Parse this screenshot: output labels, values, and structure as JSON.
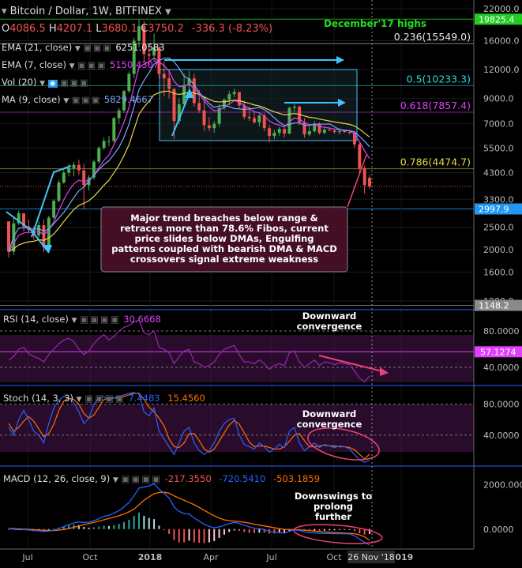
{
  "header": {
    "symbol": "Bitcoin / Dollar, 1W, BITFINEX",
    "ohlc": [
      {
        "label": "O",
        "value": "4086.5"
      },
      {
        "label": "H",
        "value": "4207.1"
      },
      {
        "label": "L",
        "value": "3680.1"
      },
      {
        "label": "C",
        "value": "3750.2"
      }
    ],
    "change": "-336.3 (-8.23%)"
  },
  "indicators": [
    {
      "label": "EMA (21, close)",
      "value": "6251.0583",
      "color": "#e8e8e8"
    },
    {
      "label": "EMA (7, close)",
      "value": "5150.4307",
      "color": "#e040fb"
    },
    {
      "label": "Vol (20)",
      "value": "",
      "color": "#26a69a"
    },
    {
      "label": "MA (9, close)",
      "value": "5829.4667",
      "color": "#7ea6ff"
    }
  ],
  "annotations": {
    "dec17": "December'17 highs",
    "note": [
      "Major trend breaches below range &",
      "retraces more than 78.6% Fibos, current",
      "price slides below DMAs, Engulfing",
      "patterns coupled with bearish DMA & MACD",
      "crossovers signal extreme weakness"
    ],
    "rsi_note": [
      "Downward",
      "convergence"
    ],
    "stoch_note": [
      "Downward",
      "convergence"
    ],
    "macd_note": [
      "Downswings to",
      "prolong further"
    ]
  },
  "chart_data": [
    {
      "type": "candlestick",
      "yscale": "log",
      "ylim": [
        1100,
        24000
      ],
      "x_ticks": [
        "Jul",
        "Oct",
        "2018",
        "Apr",
        "Jul",
        "Oct",
        "2019"
      ],
      "x_crosshair_label": "26 Nov '18",
      "y_ticks": [
        "22000.0",
        "16000.0",
        "12000.0",
        "9000.0",
        "7000.0",
        "5500.0",
        "4300.0",
        "3300.0",
        "2500.0",
        "2000.0",
        "1600.0",
        "1200.0"
      ],
      "price_tags": [
        {
          "label": "19825.4",
          "value": 19825.4,
          "color": "#22cc22"
        },
        {
          "label": "2997.9",
          "value": 2997.9,
          "color": "#2196f3"
        },
        {
          "label": "1148.2",
          "value": 1148.2,
          "color": "#8a8a8a"
        }
      ],
      "fib_levels": [
        {
          "label": "0.236(15549.0)",
          "value": 15549.0,
          "color": "#e8e8e8"
        },
        {
          "label": "0.5(10233.3)",
          "value": 10233.3,
          "color": "#2ed8d8"
        },
        {
          "label": "0.618(7857.4)",
          "value": 7857.4,
          "color": "#e040fb"
        },
        {
          "label": "0.786(4474.7)",
          "value": 4474.7,
          "color": "#e6d84a"
        }
      ],
      "ohlc_weekly": [
        [
          2650,
          2650,
          1850,
          1960
        ],
        [
          1960,
          2750,
          1900,
          2600
        ],
        [
          2600,
          2950,
          2550,
          2870
        ],
        [
          2870,
          2880,
          2400,
          2520
        ],
        [
          2520,
          2700,
          2350,
          2430
        ],
        [
          2430,
          2520,
          2200,
          2300
        ],
        [
          2300,
          2650,
          2250,
          2550
        ],
        [
          2550,
          2700,
          1950,
          2050
        ],
        [
          2050,
          2800,
          2000,
          2750
        ],
        [
          2750,
          3300,
          2700,
          3250
        ],
        [
          3250,
          4000,
          3200,
          3900
        ],
        [
          3900,
          4450,
          3850,
          4300
        ],
        [
          4300,
          4700,
          4150,
          4500
        ],
        [
          4500,
          4800,
          4150,
          4650
        ],
        [
          4650,
          4900,
          4200,
          4400
        ],
        [
          4400,
          4700,
          3000,
          3800
        ],
        [
          3800,
          4200,
          3600,
          4100
        ],
        [
          4100,
          4900,
          4000,
          4800
        ],
        [
          4800,
          5600,
          4700,
          5500
        ],
        [
          5500,
          6100,
          5400,
          5900
        ],
        [
          5900,
          6200,
          5600,
          5900
        ],
        [
          5900,
          7500,
          5800,
          7400
        ],
        [
          7400,
          8200,
          7000,
          8000
        ],
        [
          8000,
          9800,
          7800,
          9700
        ],
        [
          9700,
          11800,
          9500,
          11500
        ],
        [
          11500,
          16500,
          11000,
          16000
        ],
        [
          16000,
          19800,
          15000,
          18500
        ],
        [
          18500,
          19500,
          13000,
          14000
        ],
        [
          14000,
          15500,
          12500,
          13800
        ],
        [
          13800,
          17200,
          13000,
          15000
        ],
        [
          15000,
          15200,
          11000,
          11500
        ],
        [
          11500,
          13000,
          9200,
          11000
        ],
        [
          11000,
          12000,
          9000,
          9900
        ],
        [
          9900,
          10000,
          6000,
          7200
        ],
        [
          7200,
          9000,
          7000,
          8500
        ],
        [
          8500,
          11500,
          8400,
          10300
        ],
        [
          10300,
          11800,
          9500,
          11000
        ],
        [
          11000,
          11500,
          8300,
          8600
        ],
        [
          8600,
          9800,
          7800,
          8000
        ],
        [
          8000,
          9000,
          6500,
          6900
        ],
        [
          6900,
          7500,
          6500,
          6700
        ],
        [
          6700,
          7200,
          6400,
          7000
        ],
        [
          7000,
          8500,
          6800,
          8200
        ],
        [
          8200,
          9000,
          8000,
          8900
        ],
        [
          8900,
          9700,
          8400,
          9400
        ],
        [
          9400,
          9900,
          9100,
          9600
        ],
        [
          9600,
          9400,
          8200,
          8400
        ],
        [
          8400,
          8800,
          7300,
          7500
        ],
        [
          7500,
          8300,
          7200,
          7400
        ],
        [
          7400,
          7900,
          7000,
          7100
        ],
        [
          7100,
          7700,
          6800,
          7600
        ],
        [
          7600,
          7800,
          6500,
          6700
        ],
        [
          6700,
          6900,
          5800,
          6200
        ],
        [
          6200,
          6600,
          6000,
          6400
        ],
        [
          6400,
          6800,
          6200,
          6650
        ],
        [
          6650,
          6700,
          6100,
          6350
        ],
        [
          6350,
          8300,
          6300,
          8200
        ],
        [
          8200,
          8500,
          7900,
          8300
        ],
        [
          8300,
          8400,
          6900,
          7100
        ],
        [
          7100,
          7400,
          6100,
          6300
        ],
        [
          6300,
          6800,
          6200,
          6500
        ],
        [
          6500,
          7200,
          6400,
          7000
        ],
        [
          7000,
          7100,
          6300,
          6400
        ],
        [
          6400,
          6700,
          6300,
          6600
        ],
        [
          6600,
          6700,
          6500,
          6550
        ],
        [
          6550,
          6600,
          6350,
          6450
        ],
        [
          6450,
          6700,
          6300,
          6500
        ],
        [
          6500,
          6600,
          6400,
          6450
        ],
        [
          6450,
          6500,
          6300,
          6400
        ],
        [
          6400,
          6500,
          5500,
          5700
        ],
        [
          5700,
          5800,
          4200,
          4500
        ],
        [
          4500,
          4600,
          3500,
          3800
        ],
        [
          4086.5,
          4207.1,
          3680.1,
          3750.2
        ]
      ]
    },
    {
      "type": "line",
      "name": "RSI (14, close)",
      "value_label": "30.6668",
      "ylim": [
        20,
        100
      ],
      "y_ticks": [
        "80.0000",
        "40.0000"
      ],
      "price_tag": {
        "label": "57.1274",
        "value": 57.1274
      },
      "values": [
        48,
        52,
        60,
        62,
        55,
        52,
        50,
        46,
        54,
        60,
        66,
        70,
        72,
        68,
        60,
        54,
        58,
        66,
        72,
        76,
        70,
        74,
        80,
        84,
        86,
        90,
        92,
        78,
        76,
        80,
        62,
        60,
        56,
        44,
        52,
        58,
        60,
        46,
        44,
        40,
        42,
        46,
        54,
        60,
        62,
        64,
        54,
        46,
        46,
        44,
        48,
        44,
        38,
        42,
        44,
        42,
        56,
        58,
        46,
        40,
        44,
        48,
        42,
        46,
        45,
        43,
        45,
        44,
        43,
        36,
        28,
        24,
        30.67
      ]
    },
    {
      "type": "line",
      "name": "Stoch (14, 3, 3)",
      "value_labels": [
        "7.4483",
        "15.4560"
      ],
      "ylim": [
        0,
        100
      ],
      "y_ticks": [
        "80.0000",
        "40.0000"
      ],
      "series": [
        {
          "name": "%K",
          "values": [
            50,
            40,
            60,
            72,
            60,
            45,
            40,
            30,
            55,
            75,
            85,
            90,
            88,
            82,
            70,
            55,
            62,
            80,
            88,
            90,
            85,
            88,
            90,
            92,
            94,
            95,
            93,
            70,
            65,
            75,
            45,
            35,
            25,
            15,
            30,
            45,
            50,
            30,
            20,
            15,
            20,
            30,
            45,
            55,
            60,
            62,
            40,
            28,
            25,
            22,
            30,
            25,
            18,
            22,
            28,
            24,
            45,
            50,
            30,
            20,
            25,
            30,
            24,
            28,
            26,
            24,
            26,
            25,
            22,
            15,
            8,
            5,
            7.45
          ]
        },
        {
          "name": "%D",
          "values": [
            55,
            45,
            50,
            58,
            64,
            58,
            48,
            38,
            42,
            54,
            72,
            84,
            88,
            86,
            80,
            68,
            62,
            66,
            76,
            86,
            88,
            88,
            88,
            90,
            92,
            94,
            94,
            86,
            76,
            70,
            62,
            52,
            35,
            25,
            24,
            30,
            42,
            42,
            33,
            22,
            18,
            22,
            32,
            43,
            53,
            59,
            54,
            43,
            31,
            25,
            26,
            26,
            24,
            22,
            22,
            25,
            32,
            40,
            42,
            33,
            25,
            25,
            26,
            27,
            26,
            26,
            25,
            25,
            24,
            21,
            15,
            9,
            15.46
          ]
        }
      ]
    },
    {
      "type": "histogram+line",
      "name": "MACD (12, 26, close, 9)",
      "value_labels": [
        "-217.3550",
        "-720.5410",
        "-503.1859"
      ],
      "ylim": [
        -900,
        2700
      ],
      "y_ticks": [
        "2000.0000",
        "0.0000"
      ],
      "series": [
        {
          "name": "macd",
          "values": [
            20,
            -10,
            -30,
            -20,
            -40,
            -70,
            -80,
            -110,
            -90,
            -50,
            20,
            110,
            200,
            280,
            320,
            300,
            310,
            380,
            470,
            570,
            620,
            720,
            830,
            1000,
            1200,
            1500,
            1850,
            1900,
            1950,
            2050,
            1800,
            1620,
            1400,
            1000,
            800,
            700,
            680,
            500,
            360,
            220,
            120,
            60,
            100,
            170,
            250,
            300,
            260,
            180,
            100,
            40,
            20,
            -20,
            -100,
            -140,
            -160,
            -180,
            -100,
            -40,
            -60,
            -120,
            -160,
            -170,
            -190,
            -200,
            -200,
            -210,
            -210,
            -215,
            -220,
            -300,
            -450,
            -600,
            -720.541
          ]
        },
        {
          "name": "signal",
          "values": [
            30,
            20,
            10,
            0,
            -10,
            -25,
            -40,
            -55,
            -65,
            -65,
            -50,
            -20,
            25,
            80,
            140,
            200,
            250,
            300,
            360,
            420,
            480,
            540,
            600,
            680,
            780,
            900,
            1100,
            1300,
            1450,
            1600,
            1650,
            1660,
            1620,
            1500,
            1400,
            1300,
            1200,
            1100,
            980,
            850,
            720,
            600,
            500,
            420,
            380,
            360,
            340,
            310,
            270,
            220,
            180,
            140,
            100,
            60,
            20,
            -10,
            -20,
            -25,
            -30,
            -50,
            -70,
            -90,
            -110,
            -130,
            -145,
            -160,
            -170,
            -180,
            -190,
            -210,
            -260,
            -350,
            -503.1859
          ]
        }
      ]
    }
  ],
  "colors": {
    "up": "#4caf50",
    "down": "#ef5350",
    "rsi": "#9c27b0",
    "stoch_k": "#2962ff",
    "stoch_d": "#ff6d00",
    "macd": "#2962ff",
    "signal": "#ff6d00"
  }
}
